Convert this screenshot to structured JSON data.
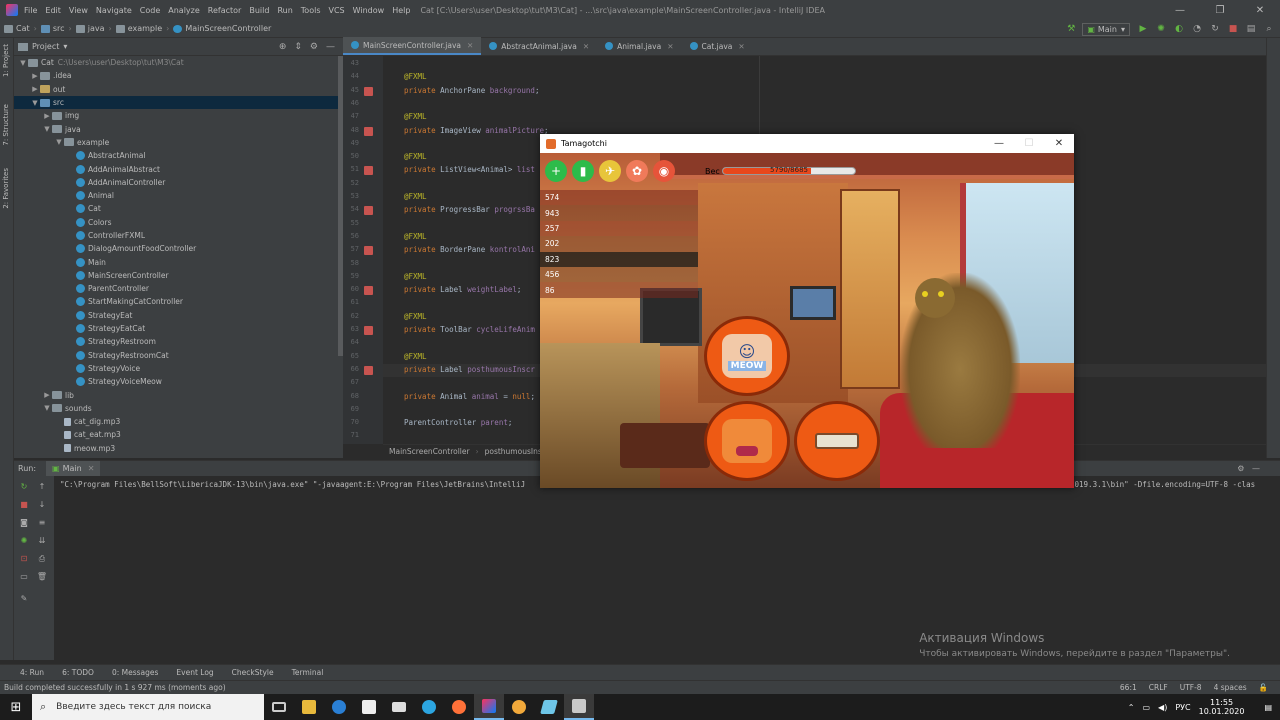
{
  "window": {
    "menu": [
      "File",
      "Edit",
      "View",
      "Navigate",
      "Code",
      "Analyze",
      "Refactor",
      "Build",
      "Run",
      "Tools",
      "VCS",
      "Window",
      "Help"
    ],
    "title": "Cat [C:\\Users\\user\\Desktop\\tut\\M3\\Cat] - ...\\src\\java\\example\\MainScreenController.java - IntelliJ IDEA"
  },
  "navbar": {
    "crumbs": [
      "Cat",
      "src",
      "java",
      "example",
      "MainScreenController"
    ],
    "run_config": "Main"
  },
  "left_strip": {
    "project": "1: Project",
    "structure": "7: Structure",
    "favorites": "2: Favorites"
  },
  "project": {
    "header": "Project",
    "tree": [
      {
        "label": "Cat",
        "extra": "C:\\Users\\user\\Desktop\\tut\\M3\\Cat",
        "icon": "folder-icon",
        "arrow": "▼"
      },
      {
        "label": ".idea",
        "icon": "folder-icon",
        "arrow": "▶"
      },
      {
        "label": "out",
        "icon": "folder-yellow-icon",
        "arrow": "▶"
      },
      {
        "label": "src",
        "icon": "folder-blue-icon",
        "arrow": "▼",
        "selected": true
      },
      {
        "label": "img",
        "icon": "folder-icon",
        "arrow": "▶"
      },
      {
        "label": "java",
        "icon": "folder-icon",
        "arrow": "▼"
      },
      {
        "label": "example",
        "icon": "folder-icon",
        "arrow": "▼"
      },
      {
        "label": "AbstractAnimal",
        "icon": "class-icon"
      },
      {
        "label": "AddAnimalAbstract",
        "icon": "class-icon"
      },
      {
        "label": "AddAnimalController",
        "icon": "class-icon"
      },
      {
        "label": "Animal",
        "icon": "class-icon"
      },
      {
        "label": "Cat",
        "icon": "class-icon"
      },
      {
        "label": "Colors",
        "icon": "class-icon"
      },
      {
        "label": "ControllerFXML",
        "icon": "class-icon"
      },
      {
        "label": "DialogAmountFoodController",
        "icon": "class-icon"
      },
      {
        "label": "Main",
        "icon": "class-icon"
      },
      {
        "label": "MainScreenController",
        "icon": "class-icon"
      },
      {
        "label": "ParentController",
        "icon": "class-icon"
      },
      {
        "label": "StartMakingCatController",
        "icon": "class-icon"
      },
      {
        "label": "StrategyEat",
        "icon": "class-icon"
      },
      {
        "label": "StrategyEatCat",
        "icon": "class-icon"
      },
      {
        "label": "StrategyRestroom",
        "icon": "class-icon"
      },
      {
        "label": "StrategyRestroomCat",
        "icon": "class-icon"
      },
      {
        "label": "StrategyVoice",
        "icon": "class-icon"
      },
      {
        "label": "StrategyVoiceMeow",
        "icon": "class-icon"
      },
      {
        "label": "lib",
        "icon": "folder-icon",
        "arrow": "▶"
      },
      {
        "label": "sounds",
        "icon": "folder-icon",
        "arrow": "▼"
      },
      {
        "label": "cat_dig.mp3",
        "icon": "file-icon"
      },
      {
        "label": "cat_eat.mp3",
        "icon": "file-icon"
      },
      {
        "label": "meow.mp3",
        "icon": "file-icon"
      }
    ]
  },
  "editor": {
    "tabs": [
      {
        "label": "MainScreenController.java",
        "active": true
      },
      {
        "label": "AbstractAnimal.java"
      },
      {
        "label": "Animal.java"
      },
      {
        "label": "Cat.java"
      }
    ],
    "lines": [
      {
        "n": "43",
        "tokens": []
      },
      {
        "n": "44",
        "tokens": [
          [
            "ann",
            "@FXML"
          ]
        ]
      },
      {
        "n": "45",
        "tokens": [
          [
            "kw",
            "private "
          ],
          [
            "ty",
            "AnchorPane "
          ],
          [
            "fld",
            "background"
          ],
          [
            "ty",
            ";"
          ]
        ],
        "gicon": true
      },
      {
        "n": "46",
        "tokens": []
      },
      {
        "n": "47",
        "tokens": [
          [
            "ann",
            "@FXML"
          ]
        ]
      },
      {
        "n": "48",
        "tokens": [
          [
            "kw",
            "private "
          ],
          [
            "ty",
            "ImageView "
          ],
          [
            "fld",
            "animalPicture"
          ],
          [
            "ty",
            ";"
          ]
        ],
        "gicon": true
      },
      {
        "n": "49",
        "tokens": []
      },
      {
        "n": "50",
        "tokens": [
          [
            "ann",
            "@FXML"
          ]
        ]
      },
      {
        "n": "51",
        "tokens": [
          [
            "kw",
            "private "
          ],
          [
            "ty",
            "ListView<Animal> "
          ],
          [
            "fld",
            "list"
          ]
        ],
        "gicon": true
      },
      {
        "n": "52",
        "tokens": []
      },
      {
        "n": "53",
        "tokens": [
          [
            "ann",
            "@FXML"
          ]
        ]
      },
      {
        "n": "54",
        "tokens": [
          [
            "kw",
            "private "
          ],
          [
            "ty",
            "ProgressBar "
          ],
          [
            "fld",
            "progrssBa"
          ]
        ],
        "gicon": true
      },
      {
        "n": "55",
        "tokens": []
      },
      {
        "n": "56",
        "tokens": [
          [
            "ann",
            "@FXML"
          ]
        ]
      },
      {
        "n": "57",
        "tokens": [
          [
            "kw",
            "private "
          ],
          [
            "ty",
            "BorderPane "
          ],
          [
            "fld",
            "kontrolAni"
          ]
        ],
        "gicon": true
      },
      {
        "n": "58",
        "tokens": []
      },
      {
        "n": "59",
        "tokens": [
          [
            "ann",
            "@FXML"
          ]
        ]
      },
      {
        "n": "60",
        "tokens": [
          [
            "kw",
            "private "
          ],
          [
            "ty",
            "Label "
          ],
          [
            "fld",
            "weightLabel"
          ],
          [
            "ty",
            ";"
          ]
        ],
        "gicon": true
      },
      {
        "n": "61",
        "tokens": []
      },
      {
        "n": "62",
        "tokens": [
          [
            "ann",
            "@FXML"
          ]
        ]
      },
      {
        "n": "63",
        "tokens": [
          [
            "kw",
            "private "
          ],
          [
            "ty",
            "ToolBar "
          ],
          [
            "fld",
            "cycleLifeAnim"
          ]
        ],
        "gicon": true
      },
      {
        "n": "64",
        "tokens": []
      },
      {
        "n": "65",
        "tokens": [
          [
            "ann",
            "@FXML"
          ]
        ]
      },
      {
        "n": "66",
        "tokens": [
          [
            "kw",
            "private "
          ],
          [
            "ty",
            "Label "
          ],
          [
            "fld",
            "posthumousInscr"
          ]
        ],
        "gicon": true,
        "current": true
      },
      {
        "n": "67",
        "tokens": []
      },
      {
        "n": "68",
        "tokens": [
          [
            "kw",
            "private "
          ],
          [
            "ty",
            "Animal "
          ],
          [
            "fld",
            "animal"
          ],
          [
            "ty",
            " = "
          ],
          [
            "kw",
            "null"
          ],
          [
            "ty",
            ";"
          ]
        ]
      },
      {
        "n": "69",
        "tokens": []
      },
      {
        "n": "70",
        "tokens": [
          [
            "ty",
            "ParentController "
          ],
          [
            "fld",
            "parent"
          ],
          [
            "ty",
            ";"
          ]
        ]
      },
      {
        "n": "71",
        "tokens": []
      }
    ],
    "breadcrumb": [
      "MainScreenController",
      "posthumousInsc"
    ]
  },
  "run": {
    "label": "Run:",
    "tab": "Main",
    "console": "\"C:\\Program Files\\BellSoft\\LibericaJDK-13\\bin\\java.exe\" \"-javaagent:E:\\Program Files\\JetBrains\\IntelliJ",
    "console_tail": "2019.3.1\\bin\" -Dfile.encoding=UTF-8 -clas"
  },
  "activation": {
    "title": "Активация Windows",
    "subtitle": "Чтобы активировать Windows, перейдите в раздел \"Параметры\"."
  },
  "toolstrip": [
    "4: Run",
    "6: TODO",
    "0: Messages",
    "Event Log",
    "CheckStyle",
    "Terminal"
  ],
  "status": {
    "message": "Build completed successfully in 1 s 927 ms (moments ago)",
    "position": "66:1",
    "line_sep": "CRLF",
    "encoding": "UTF-8",
    "indent": "4 spaces"
  },
  "taskbar": {
    "search_placeholder": "Введите здесь текст для поиска",
    "lang": "РУС",
    "time": "11:55",
    "date": "10.01.2020"
  },
  "tamagotchi": {
    "title": "Tamagotchi",
    "weight_label": "Вес",
    "weight_text": "5790/8685",
    "weight_fraction": 0.667,
    "list": [
      "574",
      "943",
      "257",
      "202",
      "823",
      "456",
      "86"
    ],
    "selected_index": 4,
    "buttons": [
      {
        "name": "add-animal-button",
        "icon": "plus-icon",
        "color": "#2dbb4a",
        "glyph": "+"
      },
      {
        "name": "drink-button",
        "icon": "bottle-icon",
        "color": "#2dbb4a",
        "glyph": "▮"
      },
      {
        "name": "travel-button",
        "icon": "airplane-icon",
        "color": "#e8c53a",
        "glyph": "✈"
      },
      {
        "name": "play-button",
        "icon": "paw-icon",
        "color": "#f07a5a",
        "glyph": "✿"
      },
      {
        "name": "sound-button",
        "icon": "sound-icon",
        "color": "#e6543a",
        "glyph": "◉"
      }
    ],
    "meow_label": "MEOW"
  },
  "colors": {
    "accent": "#4a88c7",
    "ide_bg": "#2b2b2b",
    "panel": "#3c3f41",
    "orange": "#ee5a14"
  }
}
